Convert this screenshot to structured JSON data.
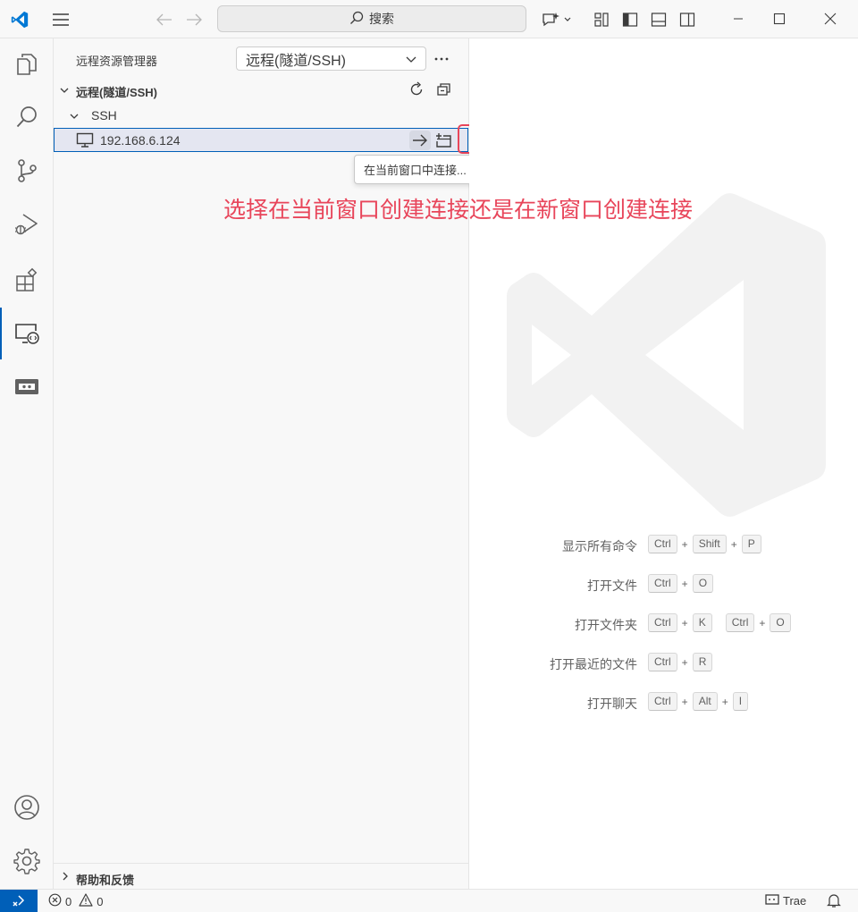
{
  "titlebar": {
    "search_label": "搜索"
  },
  "activitybar": {
    "items": [
      "explorer-icon",
      "search-icon",
      "source-control-icon",
      "run-debug-icon",
      "extensions-icon",
      "remote-explorer-icon",
      "remote-tunnel-icon"
    ],
    "active": "remote-explorer-icon",
    "bottom": [
      "account-icon",
      "settings-gear-icon"
    ]
  },
  "sidebar": {
    "title": "远程资源管理器",
    "select_value": "远程(隧道/SSH)",
    "section_title": "远程(隧道/SSH)",
    "ssh_group": "SSH",
    "host": "192.168.6.124",
    "tooltip": "在当前窗口中连接...",
    "help_section": "帮助和反馈"
  },
  "annotation": {
    "text": "选择在当前窗口创建连接还是在新窗口创建连接"
  },
  "editor": {
    "shortcuts": [
      {
        "label": "显示所有命令",
        "groups": [
          [
            "Ctrl",
            "Shift",
            "P"
          ]
        ]
      },
      {
        "label": "打开文件",
        "groups": [
          [
            "Ctrl",
            "O"
          ]
        ]
      },
      {
        "label": "打开文件夹",
        "groups": [
          [
            "Ctrl",
            "K"
          ],
          [
            "Ctrl",
            "O"
          ]
        ]
      },
      {
        "label": "打开最近的文件",
        "groups": [
          [
            "Ctrl",
            "R"
          ]
        ]
      },
      {
        "label": "打开聊天",
        "groups": [
          [
            "Ctrl",
            "Alt",
            "I"
          ]
        ]
      }
    ]
  },
  "statusbar": {
    "errors": "0",
    "warnings": "0",
    "trae_label": "Trae"
  },
  "colors": {
    "accent": "#005fb8",
    "annotation": "#e8455a",
    "vscode_logo": "#0078d4"
  }
}
